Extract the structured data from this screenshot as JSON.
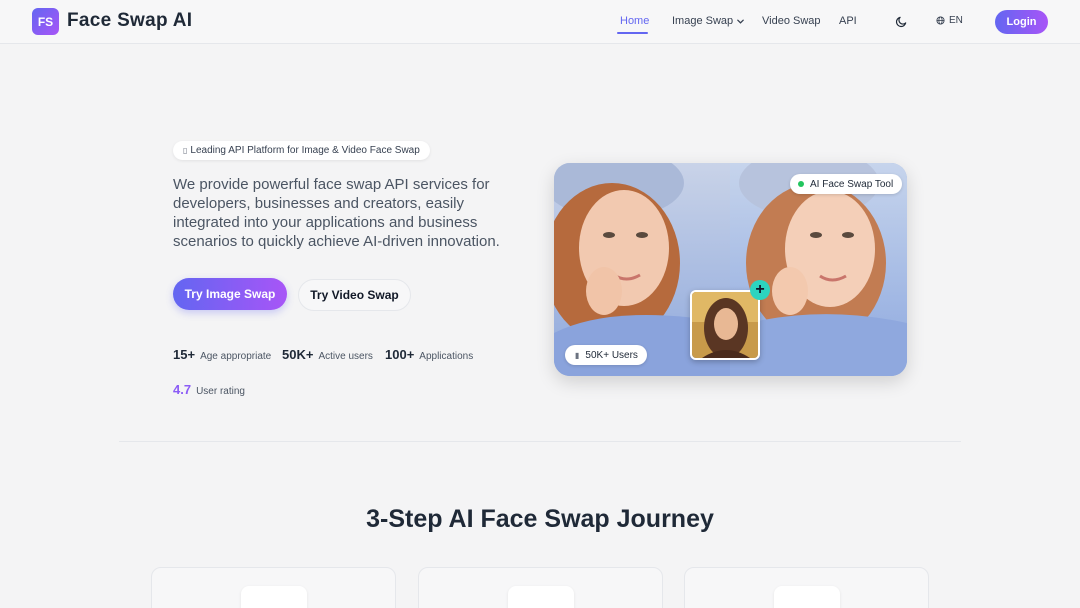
{
  "header": {
    "logo_text": "FS",
    "brand": "Face Swap AI",
    "nav": {
      "home": "Home",
      "image_swap": "Image Swap",
      "video_swap": "Video Swap",
      "api": "API"
    },
    "language": "EN",
    "login": "Login",
    "colors": {
      "accent": "#6366f1",
      "accent_end": "#a855f7"
    }
  },
  "hero": {
    "pill": "Leading API Platform for Image & Video Face Swap",
    "description": "We provide powerful face swap API services for developers, businesses and creators, easily integrated into your applications and business scenarios to quickly achieve AI-driven innovation.",
    "primary_button": "Try Image Swap",
    "secondary_button": "Try Video Swap",
    "stats": [
      {
        "value": "15+",
        "label": "Age appropriate"
      },
      {
        "value": "50K+",
        "label": "Active users"
      },
      {
        "value": "100+",
        "label": "Applications"
      },
      {
        "value": "4.7",
        "label": "User rating"
      }
    ],
    "card": {
      "tool_badge": "AI Face Swap Tool",
      "users_badge": "50K+ Users",
      "plus": "+"
    }
  },
  "steps_section": {
    "title": "3-Step AI Face Swap Journey"
  }
}
